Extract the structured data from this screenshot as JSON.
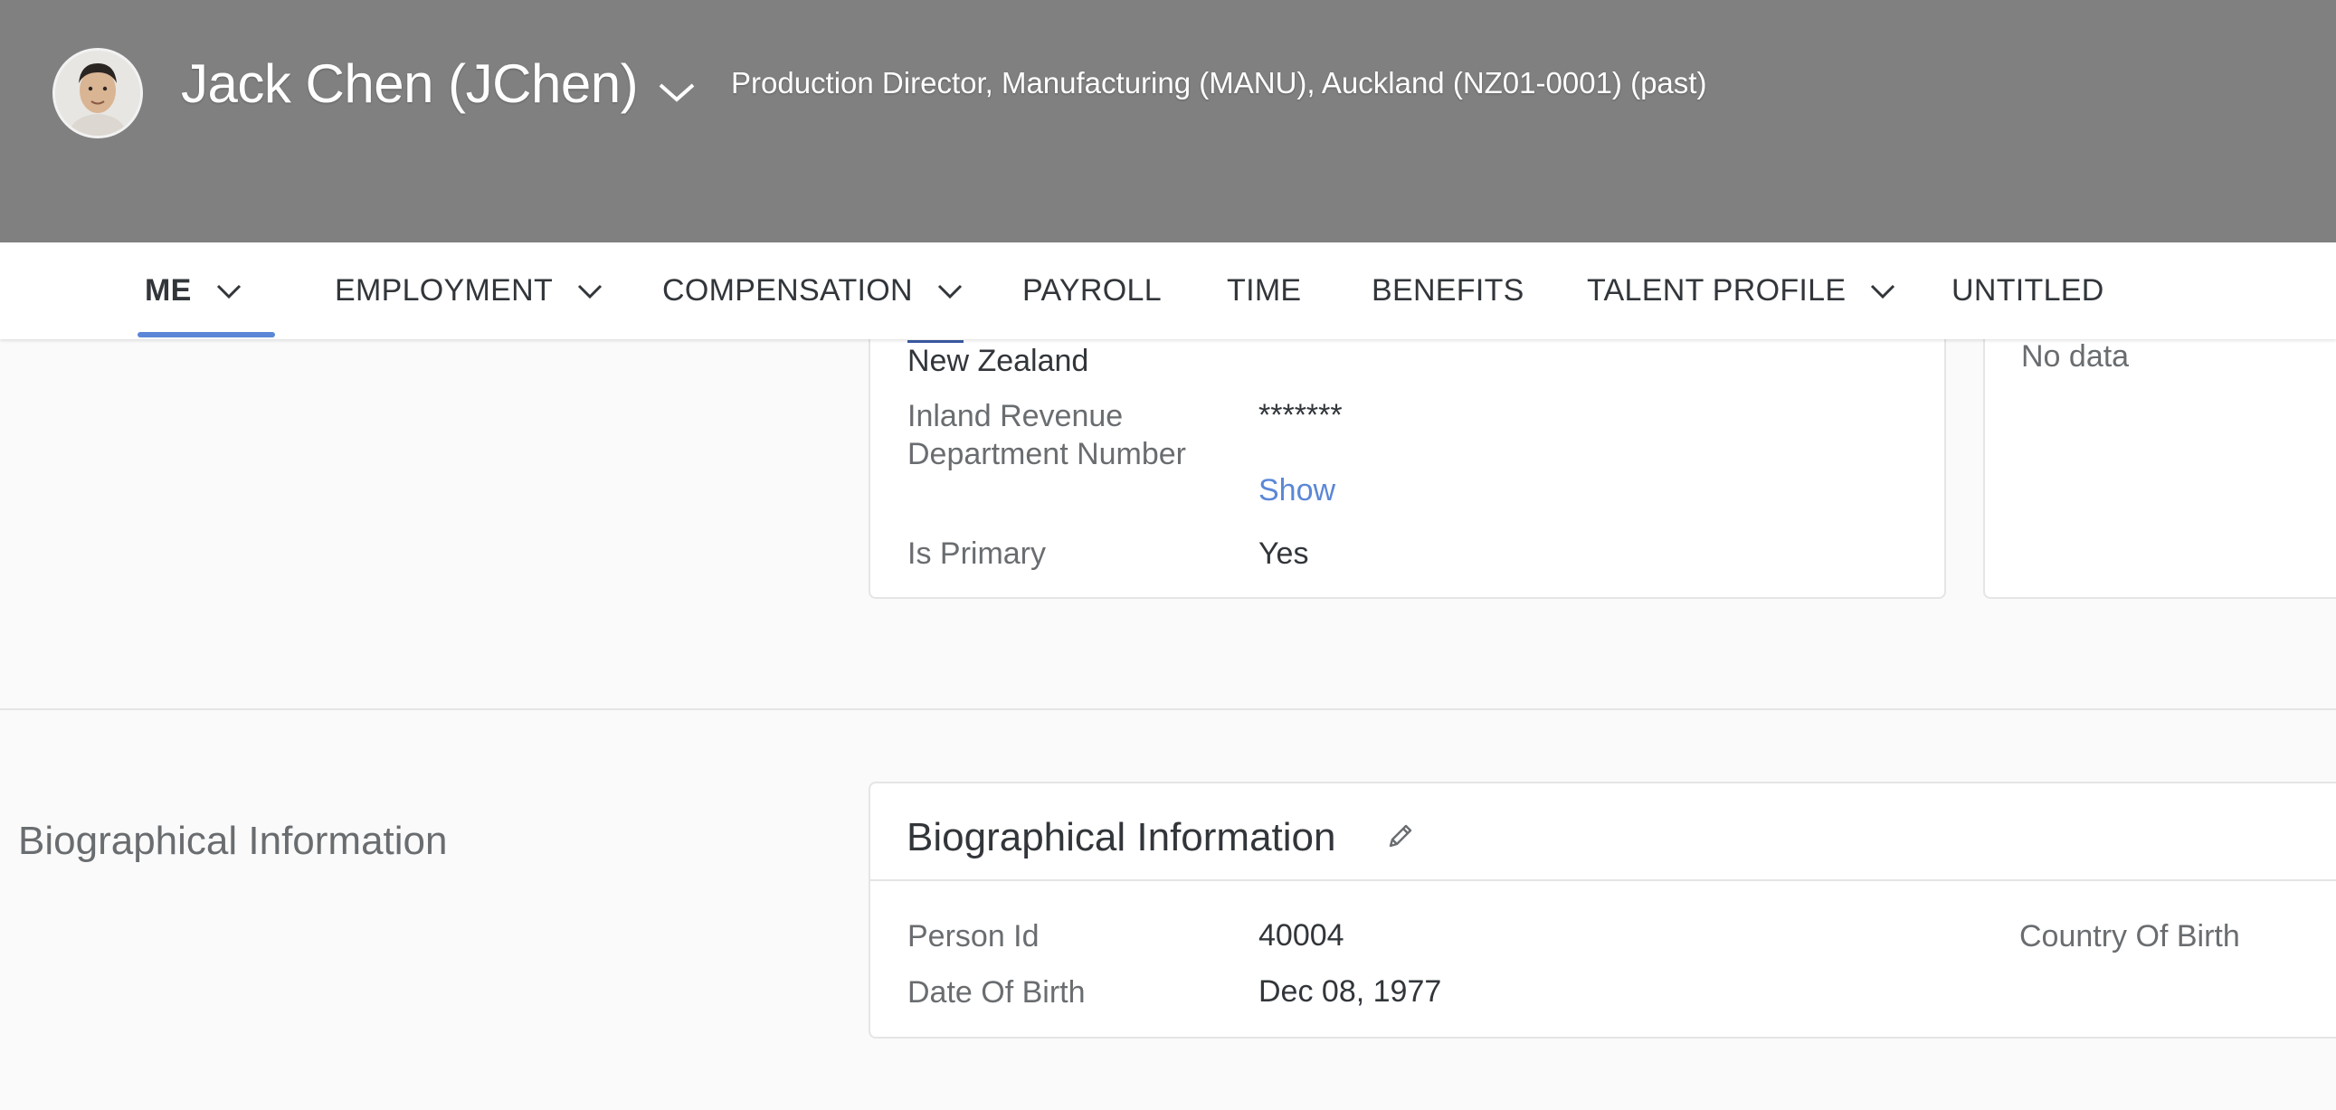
{
  "header": {
    "name": "Jack Chen (JChen)",
    "subtitle": "Production Director, Manufacturing (MANU), Auckland (NZ01-0001) (past)",
    "avatar_icon": "user-avatar-photo"
  },
  "tabs": [
    {
      "label": "ME",
      "has_menu": true,
      "active": true
    },
    {
      "label": "EMPLOYMENT",
      "has_menu": true
    },
    {
      "label": "COMPENSATION",
      "has_menu": true
    },
    {
      "label": "PAYROLL",
      "has_menu": false
    },
    {
      "label": "TIME",
      "has_menu": false
    },
    {
      "label": "BENEFITS",
      "has_menu": false
    },
    {
      "label": "TALENT PROFILE",
      "has_menu": true
    },
    {
      "label": "UNTITLED",
      "has_menu": false
    }
  ],
  "national_id_card": {
    "country": "New Zealand",
    "fields": [
      {
        "label_line1": "Inland Revenue",
        "label_line2": "Department Number",
        "value": "*******",
        "action": "Show"
      },
      {
        "label": "Is Primary",
        "value": "Yes"
      }
    ]
  },
  "side_card": {
    "text": "No data"
  },
  "biographical": {
    "section_label": "Biographical Information",
    "card_title": "Biographical Information",
    "fields": [
      {
        "label": "Person Id",
        "value": "40004"
      },
      {
        "label": "Date Of Birth",
        "value": "Dec 08, 1977"
      }
    ],
    "right_label": "Country Of Birth"
  },
  "colors": {
    "header_bg": "#808080",
    "accent": "#5b87d6",
    "page_bg": "#fafafa"
  }
}
